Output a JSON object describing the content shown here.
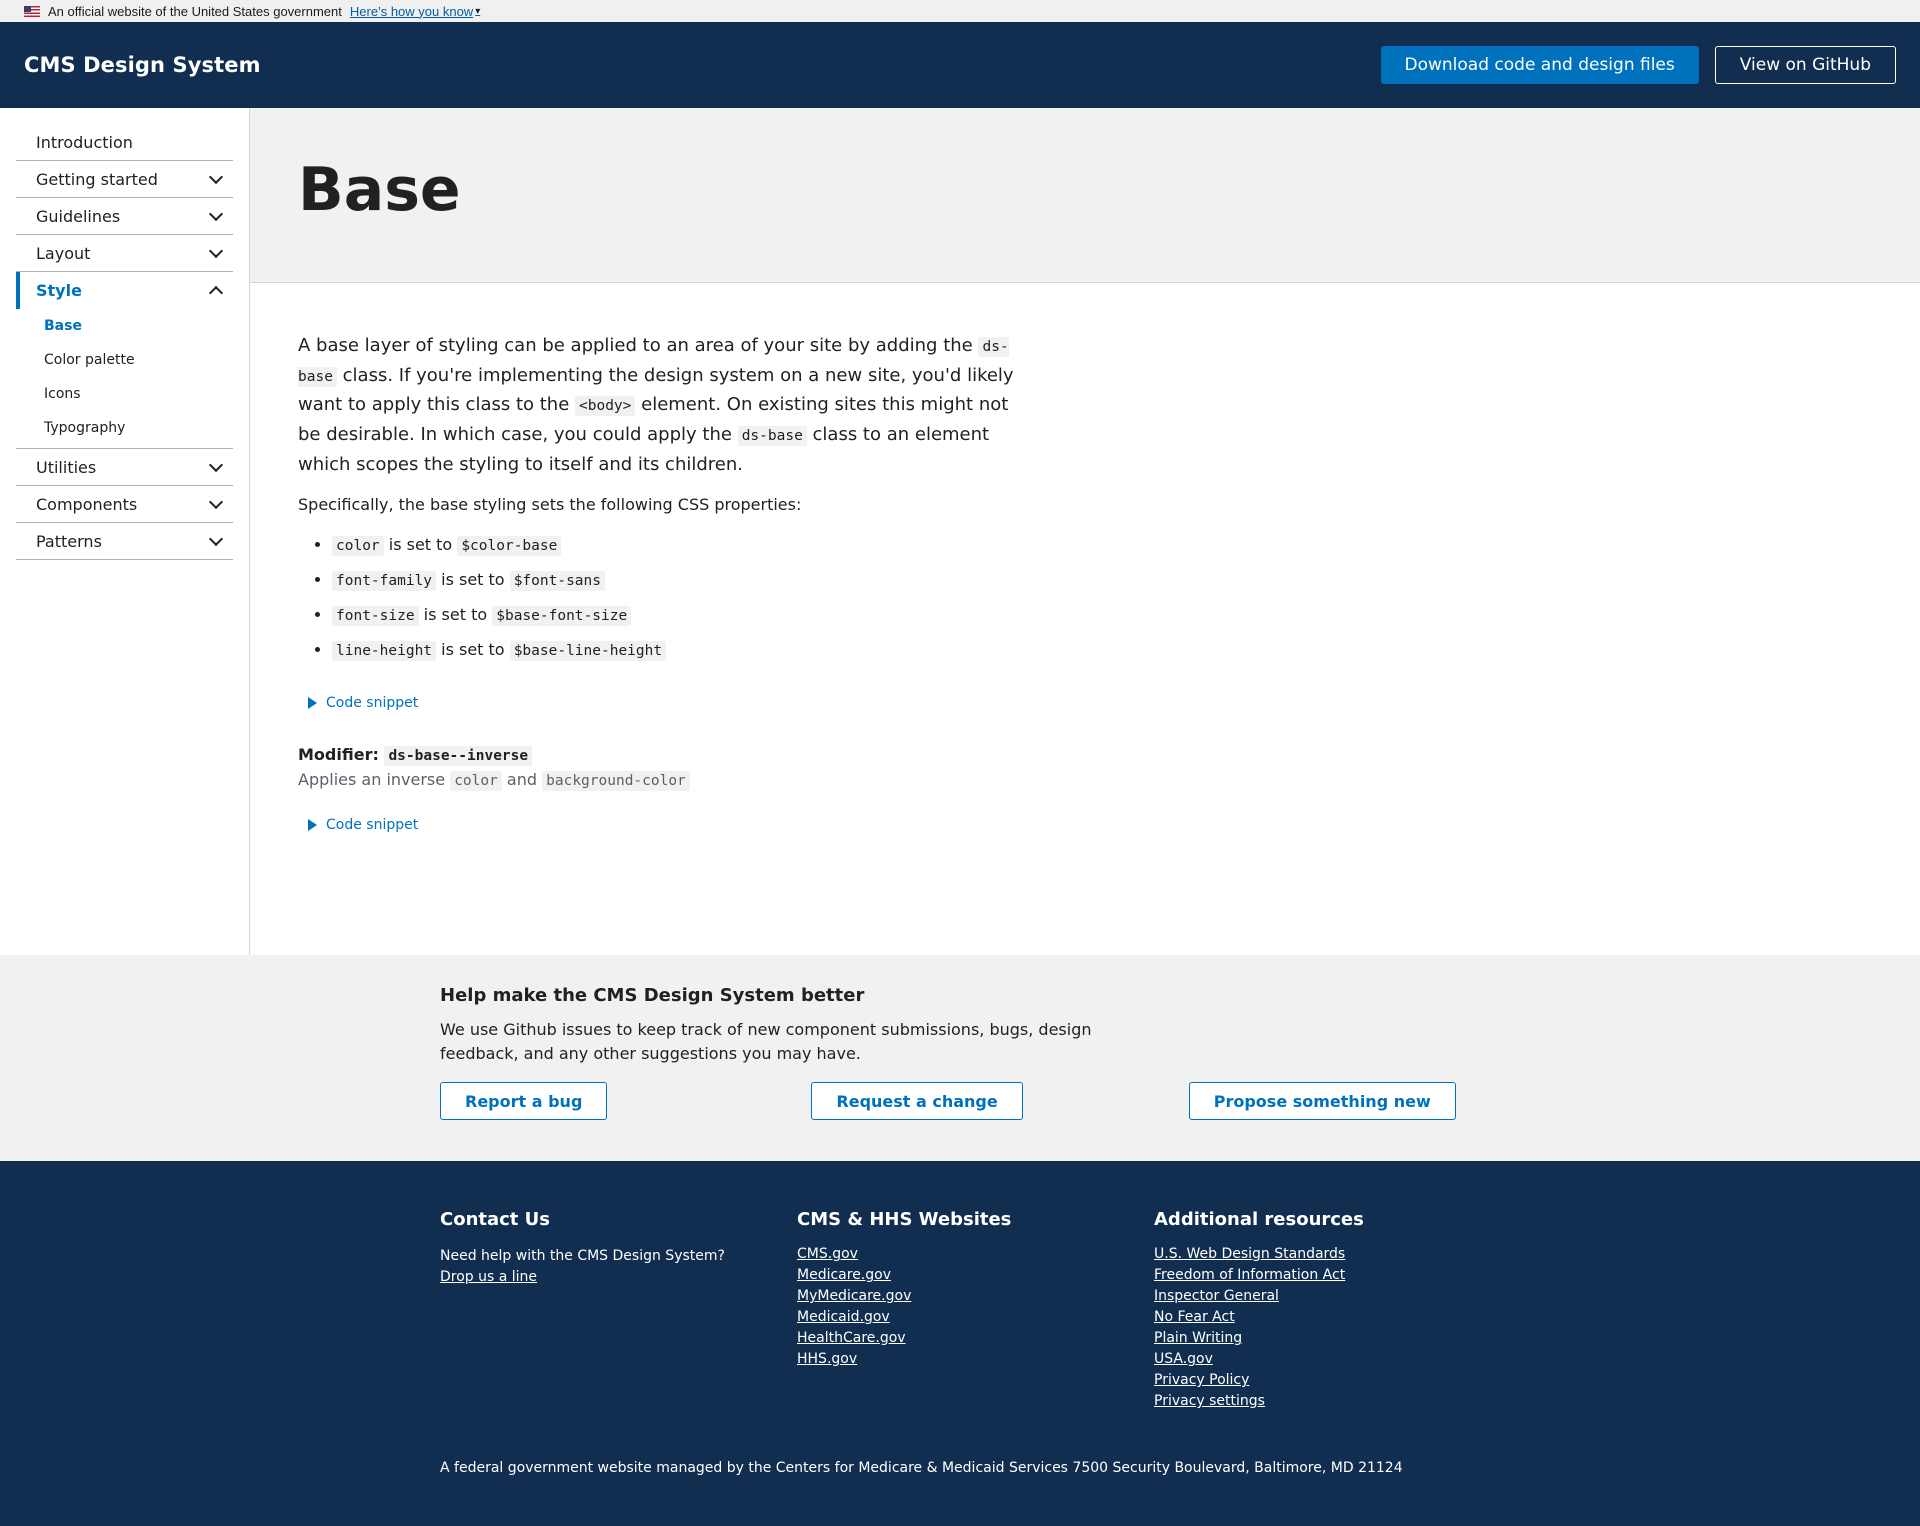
{
  "gov_banner": {
    "text": "An official website of the United States government",
    "link": "Here’s how you know"
  },
  "header": {
    "title": "CMS Design System",
    "download_button": "Download code and design files",
    "github_button": "View on GitHub"
  },
  "sidebar": {
    "items": [
      {
        "label": "Introduction"
      },
      {
        "label": "Getting started"
      },
      {
        "label": "Guidelines"
      },
      {
        "label": "Layout"
      },
      {
        "label": "Style"
      },
      {
        "label": "Utilities"
      },
      {
        "label": "Components"
      },
      {
        "label": "Patterns"
      }
    ],
    "style_subitems": [
      {
        "label": "Base"
      },
      {
        "label": "Color palette"
      },
      {
        "label": "Icons"
      },
      {
        "label": "Typography"
      }
    ]
  },
  "main": {
    "title": "Base",
    "intro": {
      "t1": "A base layer of styling can be applied to an area of your site by adding the ",
      "c1": "ds-base",
      "t2": " class. If you're implementing the design system on a new site, you'd likely want to apply this class to the ",
      "c2": "<body>",
      "t3": " element. On existing sites this might not be desirable. In which case, you could apply the ",
      "c3": "ds-base",
      "t4": " class to an element which scopes the styling to itself and its children."
    },
    "specifically": "Specifically, the base styling sets the following CSS properties:",
    "set_to": "is set to",
    "props": [
      {
        "name": "color",
        "value": "$color-base"
      },
      {
        "name": "font-family",
        "value": "$font-sans"
      },
      {
        "name": "font-size",
        "value": "$base-font-size"
      },
      {
        "name": "line-height",
        "value": "$base-line-height"
      }
    ],
    "code_snippet": "Code snippet",
    "modifier_label": "Modifier:",
    "modifier_code": "ds-base--inverse",
    "modifier_desc_1": "Applies an inverse ",
    "modifier_code_1": "color",
    "modifier_desc_2": " and ",
    "modifier_code_2": "background-color"
  },
  "feedback": {
    "heading": "Help make the CMS Design System better",
    "text": "We use Github issues to keep track of new component submissions, bugs, design feedback, and any other suggestions you may have.",
    "buttons": [
      "Report a bug",
      "Request a change",
      "Propose something new"
    ]
  },
  "footer": {
    "contact_heading": "Contact Us",
    "contact_text": "Need help with the CMS Design System?",
    "contact_link": "Drop us a line",
    "websites_heading": "CMS & HHS Websites",
    "websites": [
      "CMS.gov",
      "Medicare.gov",
      "MyMedicare.gov",
      "Medicaid.gov",
      "HealthCare.gov",
      "HHS.gov"
    ],
    "resources_heading": "Additional resources",
    "resources": [
      "U.S. Web Design Standards",
      "Freedom of Information Act",
      "Inspector General",
      "No Fear Act",
      "Plain Writing",
      "USA.gov",
      "Privacy Policy",
      "Privacy settings"
    ],
    "bottom": "A federal government website managed by the Centers for Medicare & Medicaid Services 7500 Security Boulevard, Baltimore, MD 21124"
  }
}
